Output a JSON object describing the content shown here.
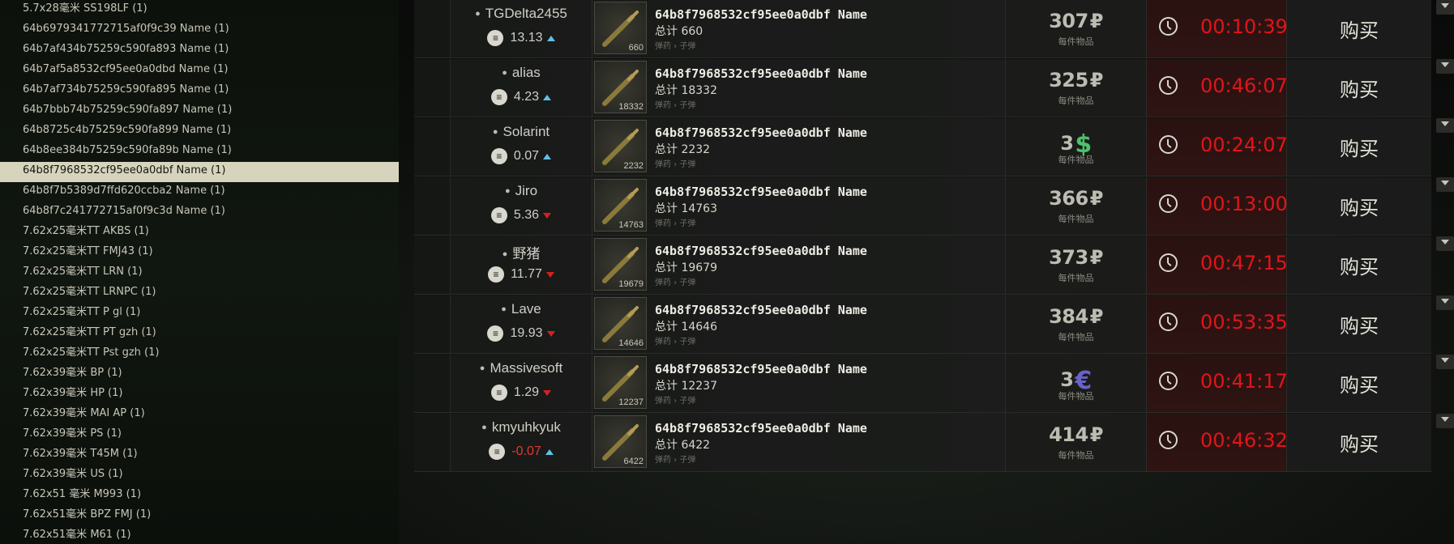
{
  "sidebar": {
    "items": [
      {
        "label": "5.7x28毫米 SS198LF (1)",
        "selected": false
      },
      {
        "label": "64b6979341772715af0f9c39 Name (1)",
        "selected": false
      },
      {
        "label": "64b7af434b75259c590fa893 Name (1)",
        "selected": false
      },
      {
        "label": "64b7af5a8532cf95ee0a0dbd Name (1)",
        "selected": false
      },
      {
        "label": "64b7af734b75259c590fa895 Name (1)",
        "selected": false
      },
      {
        "label": "64b7bbb74b75259c590fa897 Name (1)",
        "selected": false
      },
      {
        "label": "64b8725c4b75259c590fa899 Name (1)",
        "selected": false
      },
      {
        "label": "64b8ee384b75259c590fa89b Name (1)",
        "selected": false
      },
      {
        "label": "64b8f7968532cf95ee0a0dbf Name (1)",
        "selected": true
      },
      {
        "label": "64b8f7b5389d7ffd620ccba2 Name (1)",
        "selected": false
      },
      {
        "label": "64b8f7c241772715af0f9c3d Name (1)",
        "selected": false
      },
      {
        "label": "7.62x25毫米TT AKBS (1)",
        "selected": false
      },
      {
        "label": "7.62x25毫米TT FMJ43 (1)",
        "selected": false
      },
      {
        "label": "7.62x25毫米TT LRN (1)",
        "selected": false
      },
      {
        "label": "7.62x25毫米TT LRNPC (1)",
        "selected": false
      },
      {
        "label": "7.62x25毫米TT P gl (1)",
        "selected": false
      },
      {
        "label": "7.62x25毫米TT PT gzh (1)",
        "selected": false
      },
      {
        "label": "7.62x25毫米TT Pst gzh (1)",
        "selected": false
      },
      {
        "label": "7.62x39毫米 BP (1)",
        "selected": false
      },
      {
        "label": "7.62x39毫米 HP (1)",
        "selected": false
      },
      {
        "label": "7.62x39毫米 MAI AP (1)",
        "selected": false
      },
      {
        "label": "7.62x39毫米 PS (1)",
        "selected": false
      },
      {
        "label": "7.62x39毫米 T45M (1)",
        "selected": false
      },
      {
        "label": "7.62x39毫米 US (1)",
        "selected": false
      },
      {
        "label": "7.62x51 毫米 M993 (1)",
        "selected": false
      },
      {
        "label": "7.62x51毫米 BPZ FMJ (1)",
        "selected": false
      },
      {
        "label": "7.62x51毫米 M61 (1)",
        "selected": false
      }
    ]
  },
  "offers": [
    {
      "seller": "TGDelta2455",
      "rating": "13.13",
      "trend": "up",
      "rating_negative": false,
      "item_name": "64b8f7968532cf95ee0a0dbf Name",
      "total_label": "总计 660",
      "count": "660",
      "category": "弹药 › 子弹",
      "price": "307",
      "currency": "₽",
      "currency_type": "rouble",
      "per_item": "每件物品",
      "timer": "00:10:39",
      "buy": "购买"
    },
    {
      "seller": "alias",
      "rating": "4.23",
      "trend": "up",
      "rating_negative": false,
      "item_name": "64b8f7968532cf95ee0a0dbf Name",
      "total_label": "总计 18332",
      "count": "18332",
      "category": "弹药 › 子弹",
      "price": "325",
      "currency": "₽",
      "currency_type": "rouble",
      "per_item": "每件物品",
      "timer": "00:46:07",
      "buy": "购买"
    },
    {
      "seller": "Solarint",
      "rating": "0.07",
      "trend": "up",
      "rating_negative": false,
      "item_name": "64b8f7968532cf95ee0a0dbf Name",
      "total_label": "总计 2232",
      "count": "2232",
      "category": "弹药 › 子弹",
      "price": "3",
      "currency": "$",
      "currency_type": "dollar",
      "per_item": "每件物品",
      "timer": "00:24:07",
      "buy": "购买"
    },
    {
      "seller": "Jiro",
      "rating": "5.36",
      "trend": "down",
      "rating_negative": false,
      "item_name": "64b8f7968532cf95ee0a0dbf Name",
      "total_label": "总计 14763",
      "count": "14763",
      "category": "弹药 › 子弹",
      "price": "366",
      "currency": "₽",
      "currency_type": "rouble",
      "per_item": "每件物品",
      "timer": "00:13:00",
      "buy": "购买"
    },
    {
      "seller": "野猪",
      "rating": "11.77",
      "trend": "down",
      "rating_negative": false,
      "item_name": "64b8f7968532cf95ee0a0dbf Name",
      "total_label": "总计 19679",
      "count": "19679",
      "category": "弹药 › 子弹",
      "price": "373",
      "currency": "₽",
      "currency_type": "rouble",
      "per_item": "每件物品",
      "timer": "00:47:15",
      "buy": "购买"
    },
    {
      "seller": "Lave",
      "rating": "19.93",
      "trend": "down",
      "rating_negative": false,
      "item_name": "64b8f7968532cf95ee0a0dbf Name",
      "total_label": "总计 14646",
      "count": "14646",
      "category": "弹药 › 子弹",
      "price": "384",
      "currency": "₽",
      "currency_type": "rouble",
      "per_item": "每件物品",
      "timer": "00:53:35",
      "buy": "购买"
    },
    {
      "seller": "Massivesoft",
      "rating": "1.29",
      "trend": "down",
      "rating_negative": false,
      "item_name": "64b8f7968532cf95ee0a0dbf Name",
      "total_label": "总计 12237",
      "count": "12237",
      "category": "弹药 › 子弹",
      "price": "3",
      "currency": "€",
      "currency_type": "euro",
      "per_item": "每件物品",
      "timer": "00:41:17",
      "buy": "购买"
    },
    {
      "seller": "kmyuhkyuk",
      "rating": "-0.07",
      "trend": "up",
      "rating_negative": true,
      "item_name": "64b8f7968532cf95ee0a0dbf Name",
      "total_label": "总计 6422",
      "count": "6422",
      "category": "弹药 › 子弹",
      "price": "414",
      "currency": "₽",
      "currency_type": "rouble",
      "per_item": "每件物品",
      "timer": "00:46:32",
      "buy": "购买"
    }
  ],
  "colors": {
    "timer_red": "#e0151a",
    "selected_bg": "#d6d4bd",
    "trend_up": "#5fc0e8",
    "trend_down": "#d42020",
    "dollar_green": "#4cc26d",
    "euro_purple": "#6a62c9"
  }
}
